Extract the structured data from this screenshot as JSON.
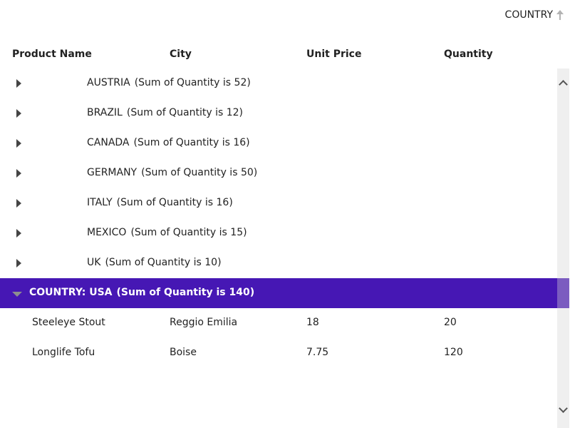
{
  "sort_chip": {
    "label": "COUNTRY",
    "direction": "ascending",
    "icon": "arrow-up-icon"
  },
  "columns": [
    {
      "label": "Product Name"
    },
    {
      "label": "City"
    },
    {
      "label": "Unit Price"
    },
    {
      "label": "Quantity"
    }
  ],
  "groups": [
    {
      "key": "AUSTRIA",
      "summary": "(Sum of Quantity is 52)",
      "expanded": false
    },
    {
      "key": "BRAZIL",
      "summary": "(Sum of Quantity is 12)",
      "expanded": false
    },
    {
      "key": "CANADA",
      "summary": "(Sum of Quantity is 16)",
      "expanded": false
    },
    {
      "key": "GERMANY",
      "summary": "(Sum of Quantity is 50)",
      "expanded": false
    },
    {
      "key": "ITALY",
      "summary": "(Sum of Quantity is 16)",
      "expanded": false
    },
    {
      "key": "MEXICO",
      "summary": "(Sum of Quantity is 15)",
      "expanded": false
    },
    {
      "key": "UK",
      "summary": "(Sum of Quantity is 10)",
      "expanded": false
    },
    {
      "key": "COUNTRY: USA",
      "summary": "(Sum of Quantity is 140)",
      "expanded": true,
      "rows": [
        {
          "product": "Steeleye Stout",
          "city": "Reggio Emilia",
          "price": "18",
          "quantity": "20"
        },
        {
          "product": "Longlife Tofu",
          "city": "Boise",
          "price": "7.75",
          "quantity": "120"
        }
      ]
    }
  ],
  "colors": {
    "selected_group": "#4617b4",
    "scroll_thumb": "#7b5cc0",
    "scrollbar_track": "#efefef"
  }
}
